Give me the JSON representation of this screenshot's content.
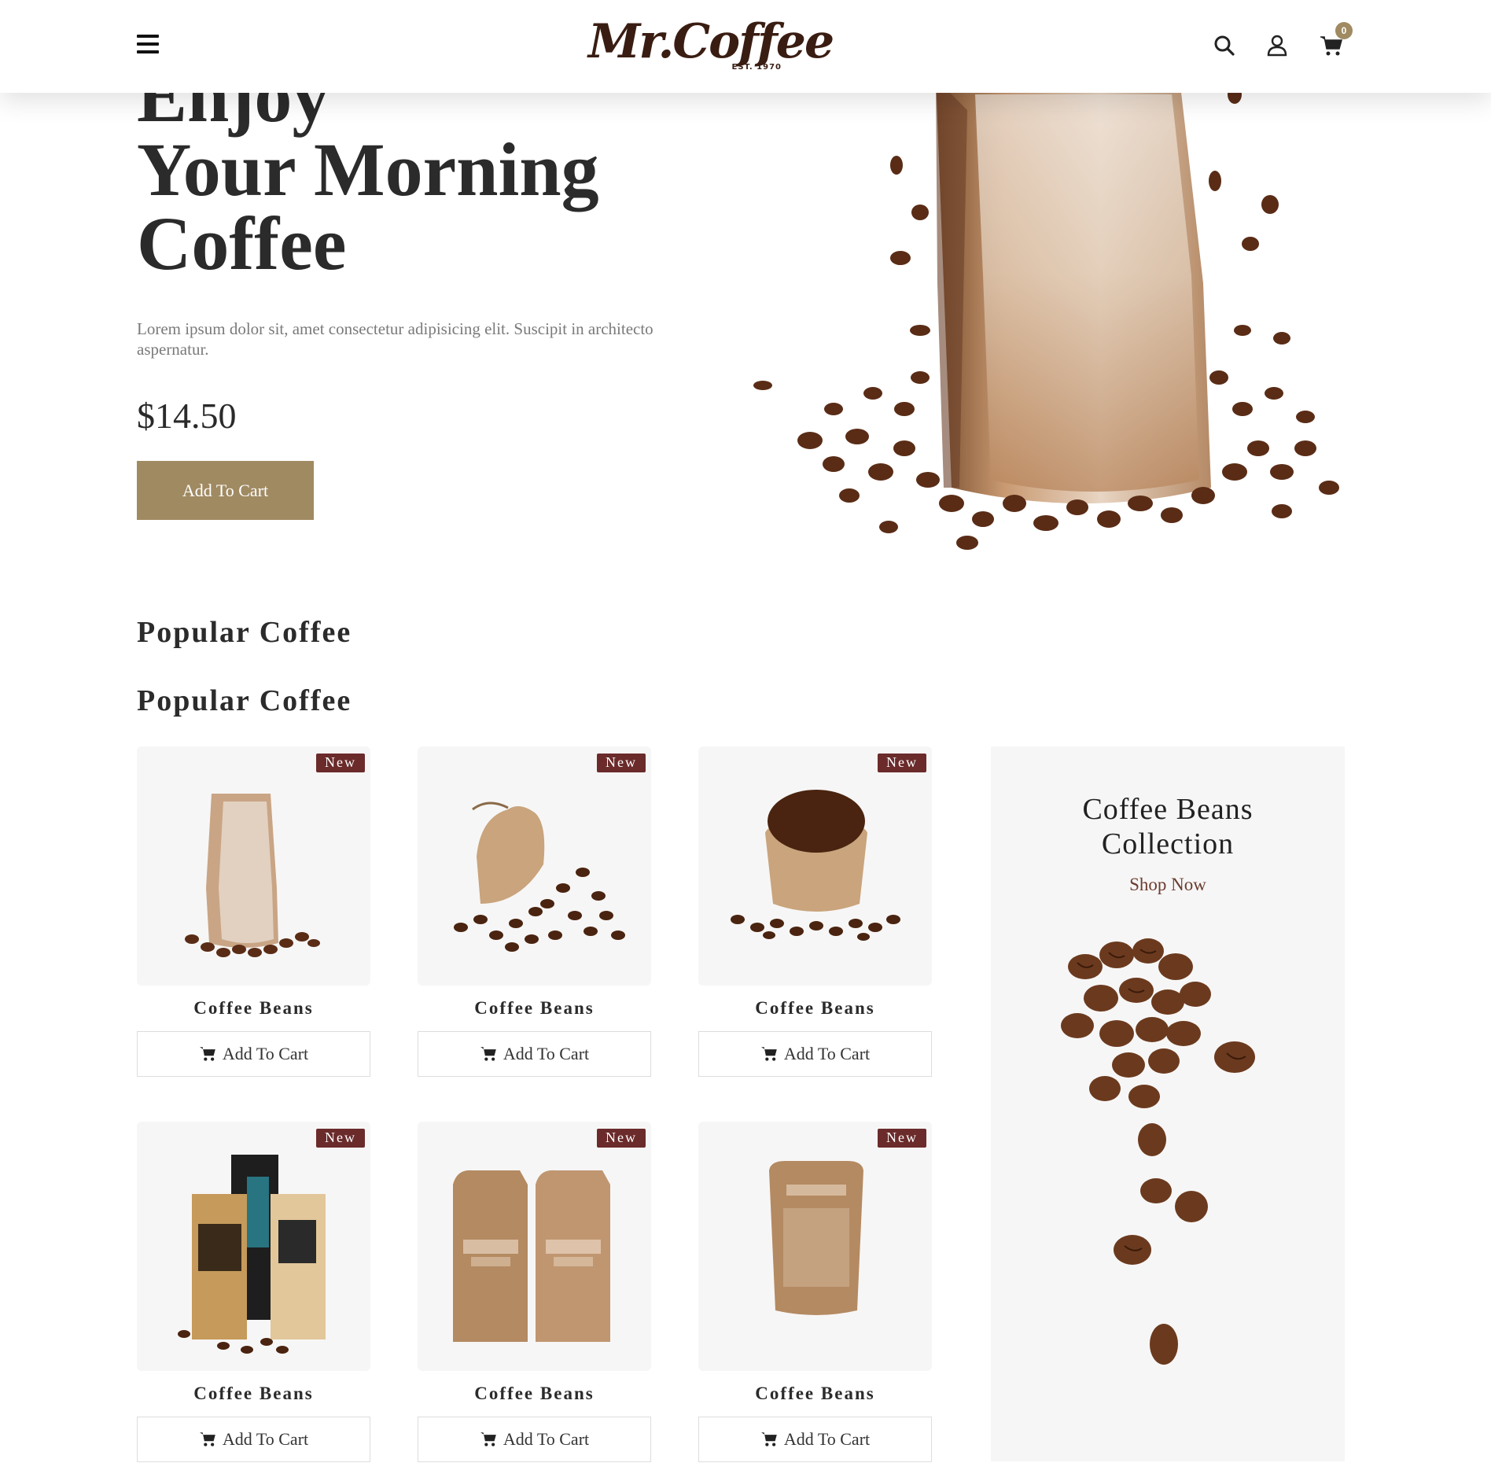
{
  "header": {
    "logo": "Mr.Coffee",
    "logo_sub": "EST. 1970",
    "cart_count": "0",
    "icons": [
      "menu-icon",
      "search-icon",
      "user-icon",
      "cart-icon"
    ]
  },
  "hero": {
    "title_line1": "Enjoy",
    "title_line2": "Your Morning",
    "title_line3": "Coffee",
    "description": "Lorem ipsum dolor sit, amet consectetur adipisicing elit. Suscipit in architecto aspernatur.",
    "price": "$14.50",
    "button": "Add To Cart"
  },
  "popular": {
    "title": "Popular Coffee",
    "title_repeat": "Popular Coffee"
  },
  "products": [
    {
      "badge": "New",
      "name": "Coffee Beans",
      "button": "Add To Cart"
    },
    {
      "badge": "New",
      "name": "Coffee Beans",
      "button": "Add To Cart"
    },
    {
      "badge": "New",
      "name": "Coffee Beans",
      "button": "Add To Cart"
    },
    {
      "badge": "New",
      "name": "Coffee Beans",
      "button": "Add To Cart"
    },
    {
      "badge": "New",
      "name": "Coffee Beans",
      "button": "Add To Cart"
    },
    {
      "badge": "New",
      "name": "Coffee Beans",
      "button": "Add To Cart"
    }
  ],
  "collection": {
    "title_line1": "Coffee Beans",
    "title_line2": "Collection",
    "link": "Shop Now"
  },
  "colors": {
    "accent": "#a08a62",
    "badge": "#6b2b2b",
    "logo": "#3a1d12",
    "link": "#6b3d30"
  }
}
